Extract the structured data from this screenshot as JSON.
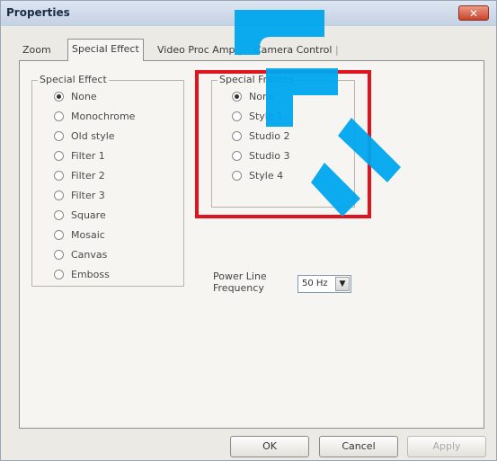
{
  "window": {
    "title": "Properties",
    "close_label": "✕"
  },
  "tabs": [
    {
      "label": "Zoom"
    },
    {
      "label": "Special Effect"
    },
    {
      "label": "Video Proc Amp"
    },
    {
      "label": "Camera Control"
    }
  ],
  "special_effect": {
    "legend": "Special Effect",
    "options": [
      {
        "label": "None",
        "checked": true
      },
      {
        "label": "Monochrome",
        "checked": false
      },
      {
        "label": "Old style",
        "checked": false
      },
      {
        "label": "Filter 1",
        "checked": false
      },
      {
        "label": "Filter 2",
        "checked": false
      },
      {
        "label": "Filter 3",
        "checked": false
      },
      {
        "label": "Square",
        "checked": false
      },
      {
        "label": "Mosaic",
        "checked": false
      },
      {
        "label": "Canvas",
        "checked": false
      },
      {
        "label": "Emboss",
        "checked": false
      }
    ]
  },
  "special_frames": {
    "legend": "Special Frames",
    "options": [
      {
        "label": "None",
        "checked": true
      },
      {
        "label": "Style 1",
        "checked": false
      },
      {
        "label": "Studio 2",
        "checked": false
      },
      {
        "label": "Studio 3",
        "checked": false
      },
      {
        "label": "Style 4",
        "checked": false
      }
    ]
  },
  "power_line": {
    "label_line1": "Power Line",
    "label_line2": "Frequency",
    "selected": "50 Hz",
    "arrow": "▼"
  },
  "buttons": {
    "ok": "OK",
    "cancel": "Cancel",
    "apply": "Apply"
  },
  "colors": {
    "highlight": "#e0141e",
    "watermark": "#00a6ee"
  }
}
